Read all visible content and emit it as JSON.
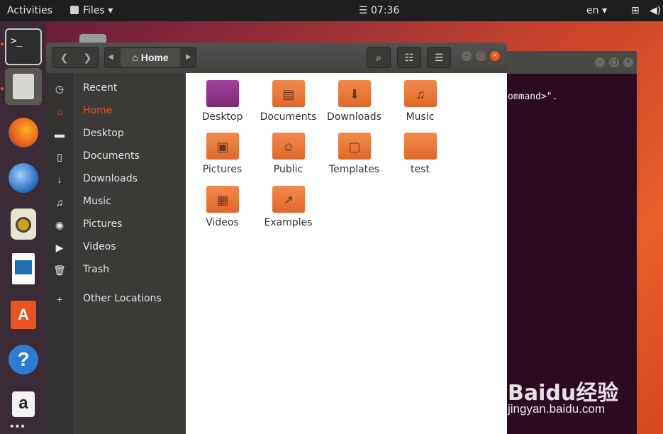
{
  "topbar": {
    "activities": "Activities",
    "app_menu": "Files",
    "clock": "07:36",
    "lang": "en"
  },
  "dock": {
    "items": [
      "terminal",
      "files",
      "firefox",
      "thunderbird",
      "rhythmbox",
      "writer",
      "software",
      "help",
      "amazon"
    ]
  },
  "terminal": {
    "visible_text": "ommand>\"."
  },
  "files": {
    "breadcrumb": {
      "location": "Home"
    },
    "sidebar": [
      {
        "label": "Recent",
        "icon": "clock-icon"
      },
      {
        "label": "Home",
        "icon": "home-icon",
        "active": true
      },
      {
        "label": "Desktop",
        "icon": "folder-icon"
      },
      {
        "label": "Documents",
        "icon": "document-icon"
      },
      {
        "label": "Downloads",
        "icon": "download-icon"
      },
      {
        "label": "Music",
        "icon": "music-icon"
      },
      {
        "label": "Pictures",
        "icon": "camera-icon"
      },
      {
        "label": "Videos",
        "icon": "video-icon"
      },
      {
        "label": "Trash",
        "icon": "trash-icon"
      },
      {
        "label": "Other Locations",
        "icon": "plus-icon"
      }
    ],
    "folders": [
      "Desktop",
      "Documents",
      "Downloads",
      "Music",
      "Pictures",
      "Public",
      "Templates",
      "test",
      "Videos",
      "Examples"
    ]
  },
  "watermark": {
    "brand": "Baidu经验",
    "url": "jingyan.baidu.com"
  },
  "colors": {
    "accent": "#e95420",
    "folder": "#f08a4b",
    "desktop_folder": "#a0409a"
  }
}
